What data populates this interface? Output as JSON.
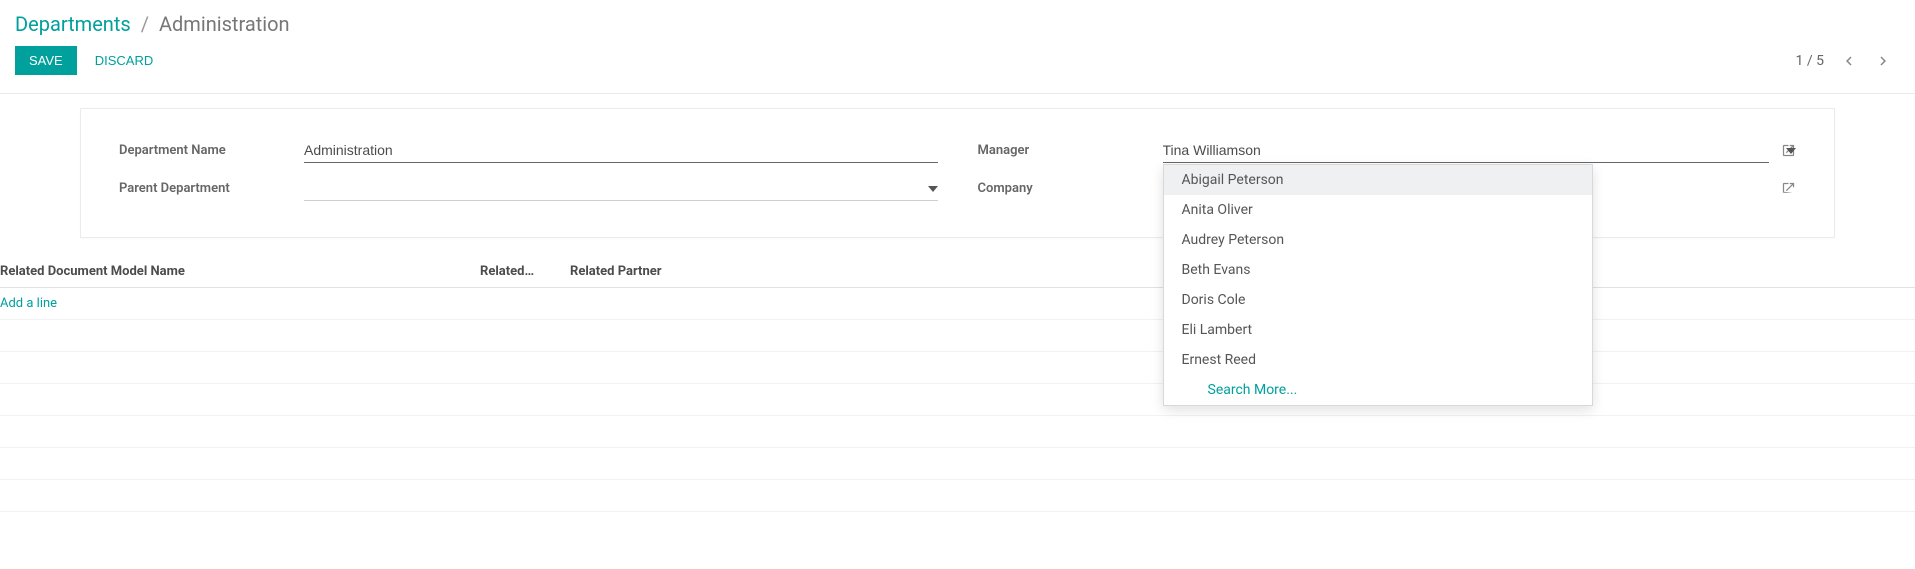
{
  "breadcrumb": {
    "root": "Departments",
    "sep": "/",
    "current": "Administration"
  },
  "actions": {
    "save": "SAVE",
    "discard": "DISCARD"
  },
  "pager": {
    "text": "1 / 5"
  },
  "form": {
    "left": {
      "department_name_label": "Department Name",
      "department_name_value": "Administration",
      "parent_department_label": "Parent Department",
      "parent_department_value": ""
    },
    "right": {
      "manager_label": "Manager",
      "manager_value": "Tina Williamson",
      "company_label": "Company",
      "company_value": ""
    }
  },
  "dropdown": {
    "items": [
      "Abigail Peterson",
      "Anita Oliver",
      "Audrey Peterson",
      "Beth Evans",
      "Doris Cole",
      "Eli Lambert",
      "Ernest Reed"
    ],
    "search_more": "Search More..."
  },
  "table": {
    "headers": {
      "h1": "Related Document Model Name",
      "h2": "Related…",
      "h3": "Related Partner"
    },
    "add_line": "Add a line"
  }
}
